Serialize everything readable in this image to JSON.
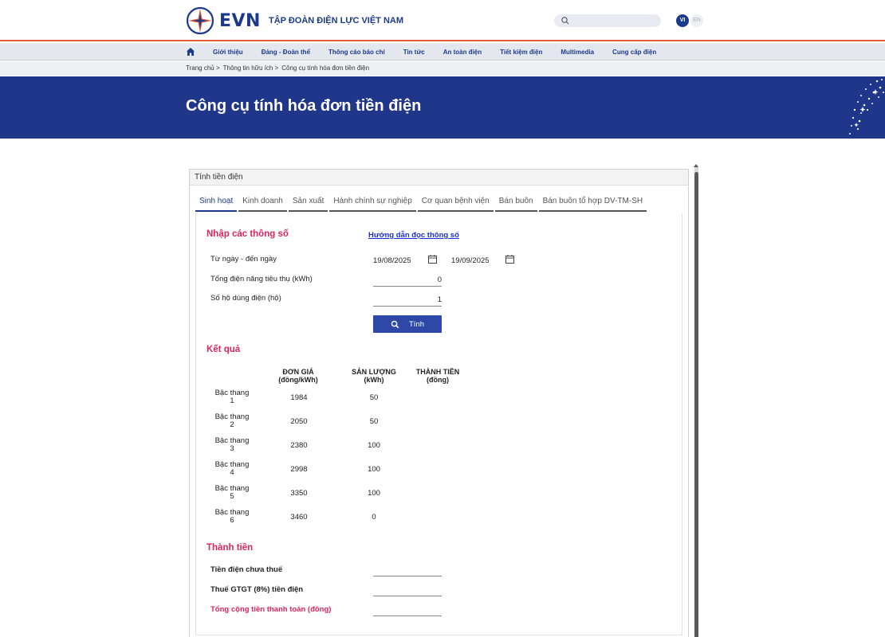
{
  "header": {
    "logo_text": "EVN",
    "org_name": "TẬP ĐOÀN ĐIỆN LỰC VIỆT NAM",
    "lang_vi": "VI",
    "lang_en": "EN"
  },
  "nav": {
    "items": [
      "Giới thiệu",
      "Đảng - Đoàn thể",
      "Thông cáo báo chí",
      "Tin tức",
      "An toàn điện",
      "Tiết kiệm điện",
      "Multimedia",
      "Cung cấp điện"
    ]
  },
  "breadcrumb": [
    "Trang chủ >",
    "Thông tin hữu ích >",
    "Công cụ tính hóa đơn tiền điện"
  ],
  "banner": {
    "title": "Công cụ tính hóa đơn tiền điện"
  },
  "panel": {
    "header": "Tính tiền điện",
    "tabs": [
      "Sinh hoạt",
      "Kinh doanh",
      "Sản xuất",
      "Hành chính sự nghiệp",
      "Cơ quan bệnh viện",
      "Bán buôn",
      "Bán buôn tổ hợp DV-TM-SH"
    ],
    "active_tab": "Sinh hoạt"
  },
  "inputs": {
    "section_title": "Nhập các thông số",
    "guide_link": "Hướng dẫn đọc thông số",
    "date_label": "Từ ngày - đến ngày",
    "date_from": "19/08/2025",
    "date_to": "19/09/2025",
    "consumption_label": "Tổng điện năng tiêu thụ (kWh)",
    "consumption_value": "0",
    "households_label": "Số hộ dùng điện (hộ)",
    "households_value": "1",
    "calc_button": "Tính"
  },
  "results": {
    "section_title": "Kết quả",
    "col_price": [
      "ĐƠN GIÁ",
      "(đồng/kWh)"
    ],
    "col_volume": [
      "SẢN LƯỢNG",
      "(kWh)"
    ],
    "col_amount": [
      "THÀNH TIỀN",
      "(đồng)"
    ],
    "tiers": [
      {
        "name": [
          "Bậc thang",
          "1"
        ],
        "price": "1984",
        "volume": "50"
      },
      {
        "name": [
          "Bậc thang",
          "2"
        ],
        "price": "2050",
        "volume": "50"
      },
      {
        "name": [
          "Bậc thang",
          "3"
        ],
        "price": "2380",
        "volume": "100"
      },
      {
        "name": [
          "Bậc thang",
          "4"
        ],
        "price": "2998",
        "volume": "100"
      },
      {
        "name": [
          "Bậc thang",
          "5"
        ],
        "price": "3350",
        "volume": "100"
      },
      {
        "name": [
          "Bậc thang",
          "6"
        ],
        "price": "3460",
        "volume": "0"
      }
    ]
  },
  "totals": {
    "section_title": "Thành tiền",
    "pre_tax": "Tiền điện chưa thuế",
    "vat": "Thuế GTGT (8%) tiền điện",
    "grand_total": "Tổng cộng tiền thanh toán (đồng)"
  },
  "colors": {
    "brand_blue": "#1b3a8c",
    "banner_blue": "#20368a",
    "accent_pink": "#e0245e",
    "header_line": "#e0603a"
  }
}
